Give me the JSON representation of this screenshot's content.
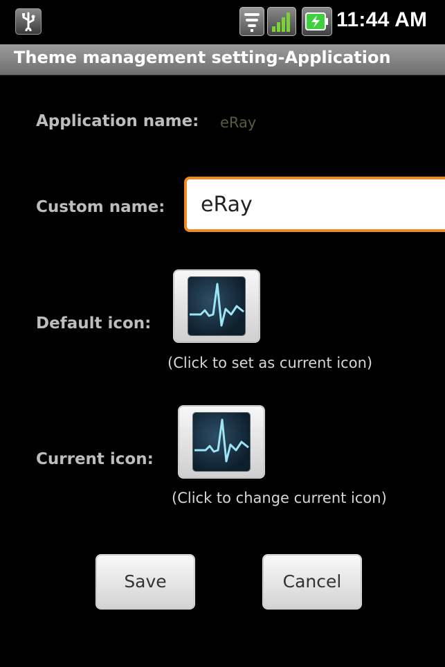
{
  "status_bar": {
    "time": "11:44 AM",
    "icons": [
      "usb-icon",
      "wifi-icon",
      "signal-icon",
      "battery-charging-icon"
    ]
  },
  "title_bar": {
    "title": "Theme management setting-Application"
  },
  "form": {
    "app_name_label": "Application name:",
    "app_name_value": "eRay",
    "custom_name_label": "Custom name:",
    "custom_name_value": "eRay",
    "default_icon_label": "Default icon:",
    "default_icon_hint": "(Click to set as current icon)",
    "current_icon_label": "Current icon:",
    "current_icon_hint": "(Click to change current icon)"
  },
  "actions": {
    "save_label": "Save",
    "cancel_label": "Cancel"
  },
  "colors": {
    "input_focus_border": "#f08a1c",
    "app_name_value": "#555e3c",
    "title_bar": "#8a8a8a"
  }
}
